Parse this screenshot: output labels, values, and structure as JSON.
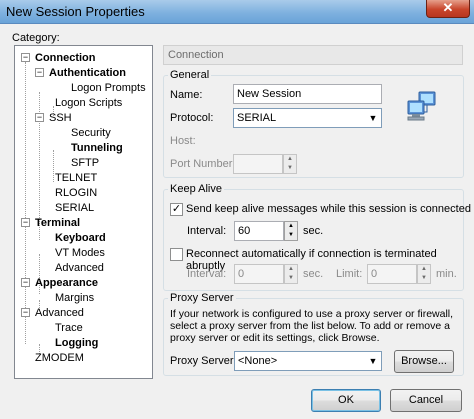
{
  "window": {
    "title": "New Session Properties",
    "close_glyph": "✕"
  },
  "category_label": "Category:",
  "tree": [
    {
      "label": "Connection",
      "bold": true
    },
    {
      "label": "Authentication",
      "bold": true
    },
    {
      "label": "Logon Prompts",
      "bold": false
    },
    {
      "label": "Logon Scripts",
      "bold": false
    },
    {
      "label": "SSH",
      "bold": false
    },
    {
      "label": "Security",
      "bold": false
    },
    {
      "label": "Tunneling",
      "bold": true
    },
    {
      "label": "SFTP",
      "bold": false
    },
    {
      "label": "TELNET",
      "bold": false
    },
    {
      "label": "RLOGIN",
      "bold": false
    },
    {
      "label": "SERIAL",
      "bold": false
    },
    {
      "label": "Terminal",
      "bold": true
    },
    {
      "label": "Keyboard",
      "bold": true
    },
    {
      "label": "VT Modes",
      "bold": false
    },
    {
      "label": "Advanced",
      "bold": false
    },
    {
      "label": "Appearance",
      "bold": true
    },
    {
      "label": "Margins",
      "bold": false
    },
    {
      "label": "Advanced",
      "bold": false
    },
    {
      "label": "Trace",
      "bold": false
    },
    {
      "label": "Logging",
      "bold": true
    },
    {
      "label": "ZMODEM",
      "bold": false
    }
  ],
  "panel_header": "Connection",
  "general": {
    "legend": "General",
    "name_label": "Name:",
    "name_value": "New Session",
    "protocol_label": "Protocol:",
    "protocol_value": "SERIAL",
    "host_label": "Host:",
    "port_label": "Port Number:",
    "port_value": ""
  },
  "keepalive": {
    "legend": "Keep Alive",
    "send_label": "Send keep alive messages while this session is connected",
    "send_checked": "✓",
    "interval_label": "Interval:",
    "interval_value": "60",
    "sec_label": "sec.",
    "reconnect_label": "Reconnect automatically if connection is terminated abruptly",
    "r_interval_label": "Interval:",
    "r_interval_value": "0",
    "r_sec_label": "sec.",
    "limit_label": "Limit:",
    "limit_value": "0",
    "min_label": "min."
  },
  "proxy": {
    "legend": "Proxy Server",
    "description": "If your network is configured to use a proxy server or firewall, select a proxy server from the list below. To add or remove a proxy server or edit its settings, click Browse.",
    "server_label": "Proxy Server:",
    "server_value": "<None>",
    "browse_label": "Browse..."
  },
  "buttons": {
    "ok": "OK",
    "cancel": "Cancel"
  }
}
